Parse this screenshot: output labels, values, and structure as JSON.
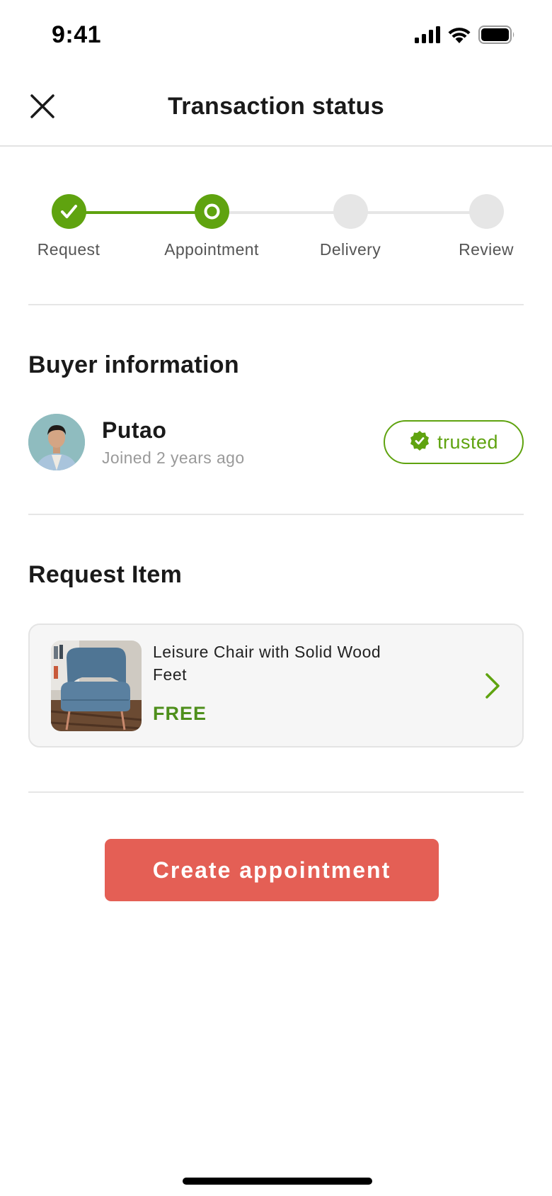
{
  "status_bar": {
    "time": "9:41",
    "icons": [
      "cellular-signal-icon",
      "wifi-icon",
      "battery-icon"
    ]
  },
  "header": {
    "title": "Transaction status",
    "close_icon": "close-icon"
  },
  "stepper": {
    "current_step": 2,
    "steps": [
      {
        "label": "Request",
        "state": "done"
      },
      {
        "label": "Appointment",
        "state": "current"
      },
      {
        "label": "Delivery",
        "state": "pending"
      },
      {
        "label": "Review",
        "state": "pending"
      }
    ]
  },
  "buyer": {
    "section_title": "Buyer information",
    "name": "Putao",
    "joined": "Joined 2 years ago",
    "badge": {
      "label": "trusted",
      "icon": "verified-badge-icon"
    }
  },
  "request_item": {
    "section_title": "Request Item",
    "title": "Leisure Chair with Solid Wood Feet",
    "price": "FREE",
    "chevron_icon": "chevron-right-icon"
  },
  "cta": {
    "label": "Create appointment"
  },
  "colors": {
    "accent_green": "#5fa30f",
    "price_green": "#4e8f1c",
    "cta_red": "#e45f55",
    "inactive_gray": "#e6e6e6"
  }
}
